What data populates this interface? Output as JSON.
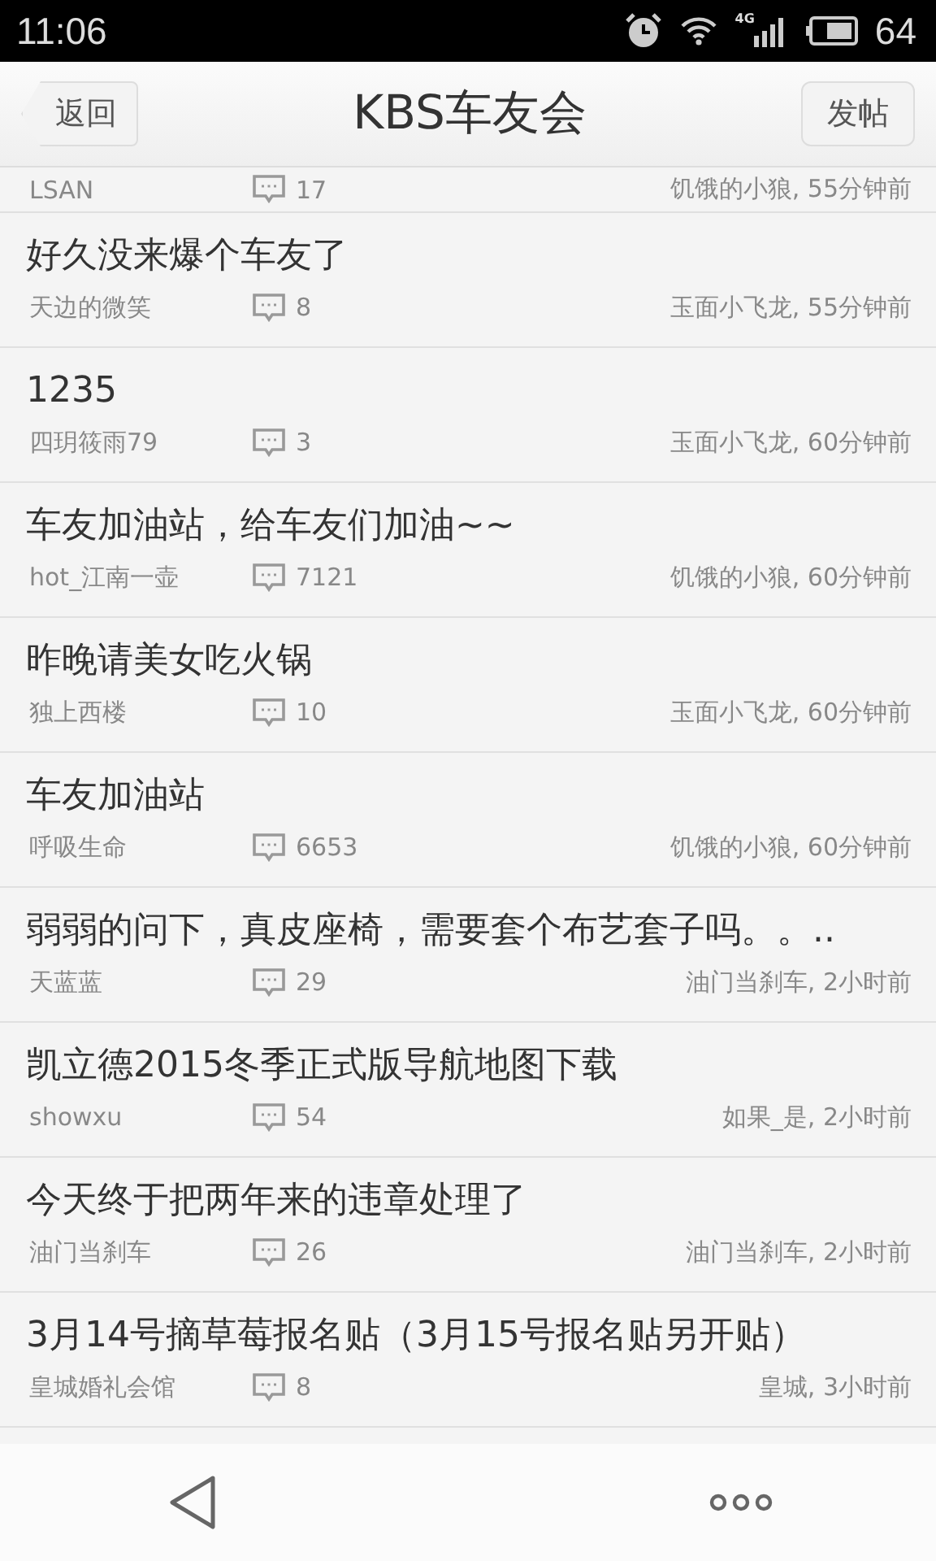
{
  "status_bar": {
    "time": "11:06",
    "network": "4G",
    "battery": "64"
  },
  "header": {
    "back": "返回",
    "title": "KBS车友会",
    "post": "发帖"
  },
  "partial_post": {
    "author": "LSAN",
    "replies": "17",
    "last_reply": "饥饿的小狼, 55分钟前"
  },
  "posts": [
    {
      "title": "好久没来爆个车友了",
      "author": "天边的微笑",
      "replies": "8",
      "last_reply": "玉面小飞龙, 55分钟前"
    },
    {
      "title": "1235",
      "author": "四玥筱雨79",
      "replies": "3",
      "last_reply": "玉面小飞龙, 60分钟前"
    },
    {
      "title": "车友加油站，给车友们加油~~",
      "author": "hot_江南一壶",
      "replies": "7121",
      "last_reply": "饥饿的小狼, 60分钟前"
    },
    {
      "title": "昨晚请美女吃火锅",
      "author": "独上西楼",
      "replies": "10",
      "last_reply": "玉面小飞龙, 60分钟前"
    },
    {
      "title": "车友加油站",
      "author": "呼吸生命",
      "replies": "6653",
      "last_reply": "饥饿的小狼, 60分钟前"
    },
    {
      "title": "弱弱的问下，真皮座椅，需要套个布艺套子吗。。..",
      "author": "天蓝蓝",
      "replies": "29",
      "last_reply": "油门当刹车, 2小时前"
    },
    {
      "title": "凯立德2015冬季正式版导航地图下载",
      "author": "showxu",
      "replies": "54",
      "last_reply": "如果_是, 2小时前"
    },
    {
      "title": "今天终于把两年来的违章处理了",
      "author": "油门当刹车",
      "replies": "26",
      "last_reply": "油门当刹车, 2小时前"
    },
    {
      "title": "3月14号摘草莓报名贴（3月15号报名贴另开贴）",
      "author": "皇城婚礼会馆",
      "replies": "8",
      "last_reply": "皇城, 3小时前"
    }
  ]
}
